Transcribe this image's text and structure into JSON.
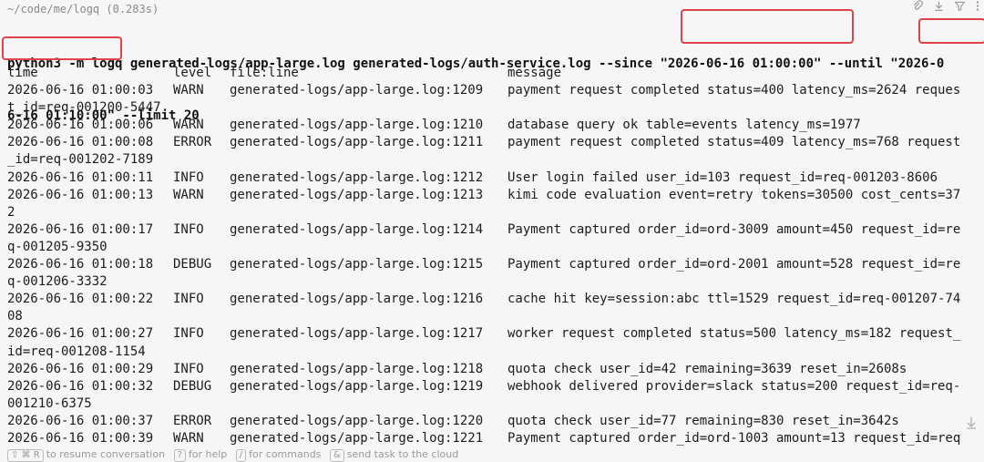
{
  "header": {
    "path_and_time": "~/code/me/logq (0.283s)",
    "toolbar_icons": [
      "attach-icon",
      "download-icon",
      "filter-icon",
      "more-vertical-icon"
    ]
  },
  "command": {
    "line1": "python3 -m logq generated-logs/app-large.log generated-logs/auth-service.log --since \"2026-06-16 01:00:00\" --until \"2026-0",
    "line2": "6-16 01:10:00\" --limit 20"
  },
  "columns": {
    "time": "time",
    "level": "level",
    "file": "file:line",
    "message": "message"
  },
  "rows": [
    {
      "time": "2026-06-16 01:00:03",
      "level": "WARN",
      "file": "generated-logs/app-large.log:1209",
      "message": "payment request completed status=400 latency_ms=2624 reques",
      "wrap": "t_id=req-001200-5447"
    },
    {
      "time": "2026-06-16 01:00:06",
      "level": "WARN",
      "file": "generated-logs/app-large.log:1210",
      "message": "database query ok table=events latency_ms=1977",
      "wrap": ""
    },
    {
      "time": "2026-06-16 01:00:08",
      "level": "ERROR",
      "file": "generated-logs/app-large.log:1211",
      "message": "payment request completed status=409 latency_ms=768 request",
      "wrap": "_id=req-001202-7189"
    },
    {
      "time": "2026-06-16 01:00:11",
      "level": "INFO",
      "file": "generated-logs/app-large.log:1212",
      "message": "User login failed user_id=103 request_id=req-001203-8606",
      "wrap": ""
    },
    {
      "time": "2026-06-16 01:00:13",
      "level": "WARN",
      "file": "generated-logs/app-large.log:1213",
      "message": "kimi code evaluation event=retry tokens=30500 cost_cents=37",
      "wrap": "2"
    },
    {
      "time": "2026-06-16 01:00:17",
      "level": "INFO",
      "file": "generated-logs/app-large.log:1214",
      "message": "Payment captured order_id=ord-3009 amount=450 request_id=re",
      "wrap": "q-001205-9350"
    },
    {
      "time": "2026-06-16 01:00:18",
      "level": "DEBUG",
      "file": "generated-logs/app-large.log:1215",
      "message": "Payment captured order_id=ord-2001 amount=528 request_id=re",
      "wrap": "q-001206-3332"
    },
    {
      "time": "2026-06-16 01:00:22",
      "level": "INFO",
      "file": "generated-logs/app-large.log:1216",
      "message": "cache hit key=session:abc ttl=1529 request_id=req-001207-74",
      "wrap": "08"
    },
    {
      "time": "2026-06-16 01:00:27",
      "level": "INFO",
      "file": "generated-logs/app-large.log:1217",
      "message": "worker request completed status=500 latency_ms=182 request_",
      "wrap": "id=req-001208-1154"
    },
    {
      "time": "2026-06-16 01:00:29",
      "level": "INFO",
      "file": "generated-logs/app-large.log:1218",
      "message": "quota check user_id=42 remaining=3639 reset_in=2608s",
      "wrap": ""
    },
    {
      "time": "2026-06-16 01:00:32",
      "level": "DEBUG",
      "file": "generated-logs/app-large.log:1219",
      "message": "webhook delivered provider=slack status=200 request_id=req-",
      "wrap": "001210-6375"
    },
    {
      "time": "2026-06-16 01:00:37",
      "level": "ERROR",
      "file": "generated-logs/app-large.log:1220",
      "message": "quota check user_id=77 remaining=830 reset_in=3642s",
      "wrap": ""
    },
    {
      "time": "2026-06-16 01:00:39",
      "level": "WARN",
      "file": "generated-logs/app-large.log:1221",
      "message": "Payment captured order_id=ord-1003 amount=13 request_id=req",
      "wrap": ""
    }
  ],
  "footer": {
    "key1": "⇧ ⌘ R",
    "text1": "to resume conversation",
    "key2": "?",
    "text2": "for help",
    "key3": "/",
    "text3": "for commands",
    "key4": "&",
    "text4": "send task to the cloud"
  },
  "colors": {
    "background": "#f6f6f6",
    "text": "#1c1c1c",
    "highlight_border": "#e0444a"
  }
}
